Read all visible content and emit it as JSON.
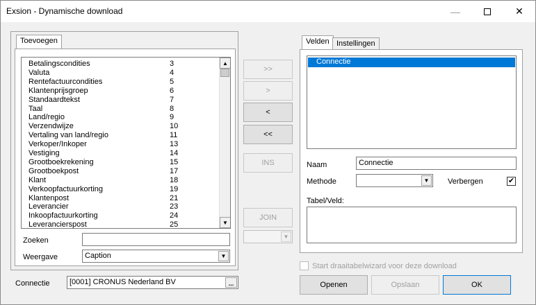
{
  "window": {
    "title": "Exsion - Dynamische download",
    "minimize_glyph": "—",
    "close_glyph": "✕"
  },
  "left": {
    "tab_label": "Toevoegen",
    "items": [
      {
        "name": "Betalingscondities",
        "num": "3"
      },
      {
        "name": "Valuta",
        "num": "4"
      },
      {
        "name": "Rentefactuurcondities",
        "num": "5"
      },
      {
        "name": "Klantenprijsgroep",
        "num": "6"
      },
      {
        "name": "Standaardtekst",
        "num": "7"
      },
      {
        "name": "Taal",
        "num": "8"
      },
      {
        "name": "Land/regio",
        "num": "9"
      },
      {
        "name": "Verzendwijze",
        "num": "10"
      },
      {
        "name": "Vertaling van land/regio",
        "num": "11"
      },
      {
        "name": "Verkoper/Inkoper",
        "num": "13"
      },
      {
        "name": "Vestiging",
        "num": "14"
      },
      {
        "name": "Grootboekrekening",
        "num": "15"
      },
      {
        "name": "Grootboekpost",
        "num": "17"
      },
      {
        "name": "Klant",
        "num": "18"
      },
      {
        "name": "Verkoopfactuurkorting",
        "num": "19"
      },
      {
        "name": "Klantenpost",
        "num": "21"
      },
      {
        "name": "Leverancier",
        "num": "23"
      },
      {
        "name": "Inkoopfactuurkorting",
        "num": "24"
      },
      {
        "name": "Leverancierspost",
        "num": "25"
      }
    ],
    "search_label": "Zoeken",
    "search_value": "",
    "display_label": "Weergave",
    "display_value": "Caption"
  },
  "middle": {
    "add_all_label": ">>",
    "add_label": ">",
    "remove_label": "<",
    "remove_all_label": "<<",
    "ins_label": "INS",
    "join_label": "JOIN",
    "join_combo_value": ""
  },
  "right": {
    "tab_fields_label": "Velden",
    "tab_settings_label": "Instellingen",
    "fields_list": [
      "Connectie"
    ],
    "name_label": "Naam",
    "name_value": "Connectie",
    "method_label": "Methode",
    "method_value": "",
    "hide_label": "Verbergen",
    "hide_checked_glyph": "✔",
    "table_field_label": "Tabel/Veld:",
    "table_field_value": ""
  },
  "bottom": {
    "connection_label": "Connectie",
    "connection_value": "[0001] CRONUS Nederland BV",
    "ellipsis_label": "...",
    "pivot_wizard_label": "Start draaitabelwizard voor deze download",
    "open_label": "Openen",
    "save_label": "Opslaan",
    "ok_label": "OK"
  },
  "icons": {
    "scroll_up": "▲",
    "scroll_down": "▼",
    "combo_arrow": "▼"
  }
}
